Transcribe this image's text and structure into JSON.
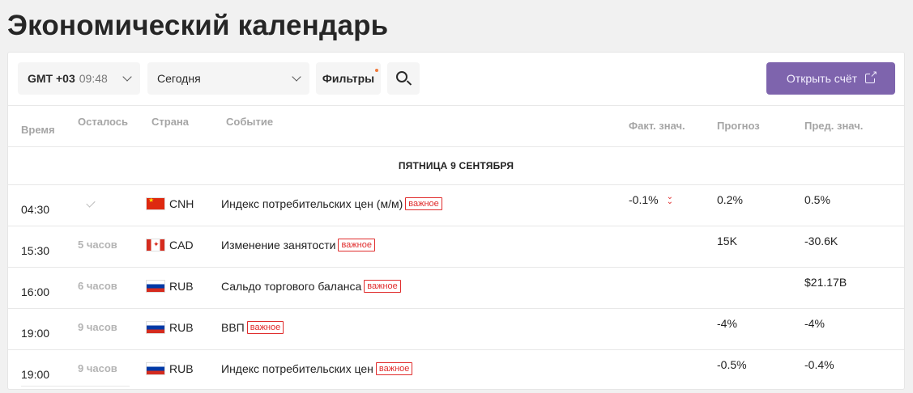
{
  "page": {
    "title": "Экономический календарь"
  },
  "toolbar": {
    "timezone_gmt": "GMT +03",
    "timezone_time": "09:48",
    "day_selected": "Сегодня",
    "filters_label": "Фильтры",
    "open_account_label": "Открыть счёт"
  },
  "table": {
    "headers": {
      "time": "Время",
      "left": "Осталось",
      "country": "Страна",
      "event": "Событие",
      "actual": "Факт. знач.",
      "forecast": "Прогноз",
      "previous": "Пред. знач."
    },
    "date_label": "ПЯТНИЦА 9 СЕНТЯБРЯ",
    "rows": [
      {
        "time": "04:30",
        "left": "",
        "country": "CNH",
        "flag": "cn",
        "event": "Индекс потребительских цен (м/м)",
        "badge": "важное",
        "actual": "-0.1%",
        "forecast": "0.2%",
        "previous": "0.5%"
      },
      {
        "time": "15:30",
        "left": "5 часов",
        "country": "CAD",
        "flag": "ca",
        "event": "Изменение занятости",
        "badge": "важное",
        "actual": "",
        "forecast": "15K",
        "previous": "-30.6K"
      },
      {
        "time": "16:00",
        "left": "6 часов",
        "country": "RUB",
        "flag": "ru",
        "event": "Сальдо торгового баланса",
        "badge": "важное",
        "actual": "",
        "forecast": "",
        "previous": "$21.17B"
      },
      {
        "time": "19:00",
        "left": "9 часов",
        "country": "RUB",
        "flag": "ru",
        "event": "ВВП",
        "badge": "важное",
        "actual": "",
        "forecast": "-4%",
        "previous": "-4%"
      },
      {
        "time": "19:00",
        "left": "9 часов",
        "country": "RUB",
        "flag": "ru",
        "event": "Индекс потребительских цен",
        "badge": "важное",
        "actual": "",
        "forecast": "-0.5%",
        "previous": "-0.4%"
      }
    ]
  },
  "colors": {
    "accent_button": "#7e64ad",
    "important_badge": "#e02c2c",
    "filter_indicator": "#f07a3a"
  },
  "icons": {
    "timezone_dropdown": "chevron-down-icon",
    "day_dropdown": "chevron-down-icon",
    "search": "search-icon",
    "open_account": "external-link-icon",
    "past_event": "check-icon",
    "actual_worse": "double-chevron-down-icon"
  }
}
